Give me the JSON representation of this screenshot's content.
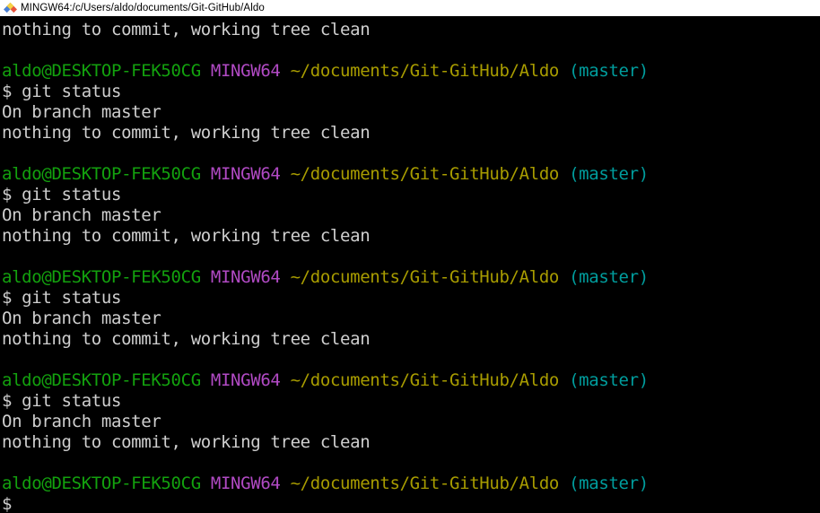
{
  "window": {
    "title": "MINGW64:/c/Users/aldo/documents/Git-GitHub/Aldo",
    "icon": "mintty-diamond-icon"
  },
  "colors": {
    "background": "#000000",
    "foreground": "#cfcfcf",
    "titlebar_bg": "#ffffff",
    "titlebar_fg": "#000000",
    "green": "#13a10e",
    "magenta": "#b14ac4",
    "yellow": "#a89c00",
    "cyan": "#009d9d"
  },
  "prompt": {
    "user_host": "aldo@DESKTOP-FEK50CG",
    "tty": "MINGW64",
    "path": "~/documents/Git-GitHub/Aldo",
    "branch": "(master)",
    "sigil": "$"
  },
  "command": "git status",
  "output": {
    "branch_line": "On branch master",
    "clean_line": "nothing to commit, working tree clean"
  },
  "terminal_lines": [
    {
      "type": "output",
      "text": "nothing to commit, working tree clean"
    },
    {
      "type": "blank",
      "text": " "
    },
    {
      "type": "prompt"
    },
    {
      "type": "command",
      "text": "$ git status"
    },
    {
      "type": "output",
      "text": "On branch master"
    },
    {
      "type": "output",
      "text": "nothing to commit, working tree clean"
    },
    {
      "type": "blank",
      "text": " "
    },
    {
      "type": "prompt"
    },
    {
      "type": "command",
      "text": "$ git status"
    },
    {
      "type": "output",
      "text": "On branch master"
    },
    {
      "type": "output",
      "text": "nothing to commit, working tree clean"
    },
    {
      "type": "blank",
      "text": " "
    },
    {
      "type": "prompt"
    },
    {
      "type": "command",
      "text": "$ git status"
    },
    {
      "type": "output",
      "text": "On branch master"
    },
    {
      "type": "output",
      "text": "nothing to commit, working tree clean"
    },
    {
      "type": "blank",
      "text": " "
    },
    {
      "type": "prompt"
    },
    {
      "type": "command",
      "text": "$ git status"
    },
    {
      "type": "output",
      "text": "On branch master"
    },
    {
      "type": "output",
      "text": "nothing to commit, working tree clean"
    },
    {
      "type": "blank",
      "text": " "
    },
    {
      "type": "prompt"
    },
    {
      "type": "sigil",
      "text": "$"
    }
  ]
}
